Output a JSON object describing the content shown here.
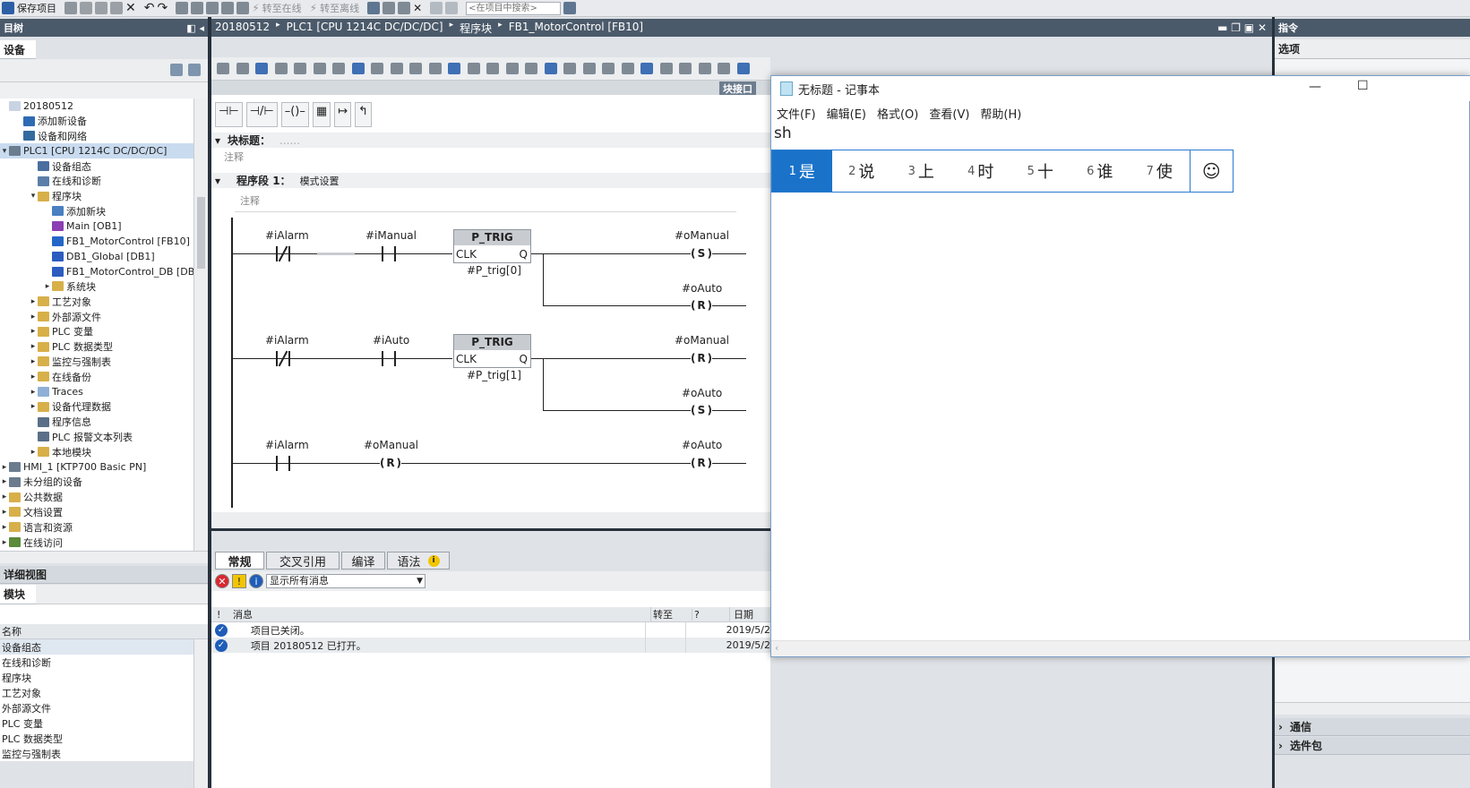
{
  "toolbar": {
    "save": "保存项目",
    "go_online": "转至在线",
    "go_offline": "转至离线",
    "search_placeholder": "<在项目中搜索>"
  },
  "left": {
    "project_tree_title": "目树",
    "devices_tab": "设备",
    "detail_view": "详细视图",
    "module_tab": "模块",
    "col_name": "名称"
  },
  "tree": [
    {
      "label": "20180512",
      "indent": 0,
      "arrow": "",
      "icon": "#c8d4e2"
    },
    {
      "label": "添加新设备",
      "indent": 1,
      "arrow": "",
      "icon": "#2f6bb3"
    },
    {
      "label": "设备和网络",
      "indent": 1,
      "arrow": "",
      "icon": "#356a9e"
    },
    {
      "label": "PLC1 [CPU 1214C DC/DC/DC]",
      "indent": 0,
      "arrow": "▾",
      "icon": "#6b7c8f",
      "sel": true
    },
    {
      "label": "设备组态",
      "indent": 2,
      "arrow": "",
      "icon": "#4b6ea0"
    },
    {
      "label": "在线和诊断",
      "indent": 2,
      "arrow": "",
      "icon": "#5b7fa8"
    },
    {
      "label": "程序块",
      "indent": 2,
      "arrow": "▾",
      "icon": "#d7b04a"
    },
    {
      "label": "添加新块",
      "indent": 3,
      "arrow": "",
      "icon": "#4a7fc1"
    },
    {
      "label": "Main [OB1]",
      "indent": 3,
      "arrow": "",
      "icon": "#8b3fb3"
    },
    {
      "label": "FB1_MotorControl [FB10]",
      "indent": 3,
      "arrow": "",
      "icon": "#2466c8"
    },
    {
      "label": "DB1_Global [DB1]",
      "indent": 3,
      "arrow": "",
      "icon": "#2c5cc0"
    },
    {
      "label": "FB1_MotorControl_DB [DB...",
      "indent": 3,
      "arrow": "",
      "icon": "#2c5cc0"
    },
    {
      "label": "系统块",
      "indent": 3,
      "arrow": "▸",
      "icon": "#d7b04a"
    },
    {
      "label": "工艺对象",
      "indent": 2,
      "arrow": "▸",
      "icon": "#d7b04a"
    },
    {
      "label": "外部源文件",
      "indent": 2,
      "arrow": "▸",
      "icon": "#d7b04a"
    },
    {
      "label": "PLC 变量",
      "indent": 2,
      "arrow": "▸",
      "icon": "#d7b04a"
    },
    {
      "label": "PLC 数据类型",
      "indent": 2,
      "arrow": "▸",
      "icon": "#d7b04a"
    },
    {
      "label": "监控与强制表",
      "indent": 2,
      "arrow": "▸",
      "icon": "#d7b04a"
    },
    {
      "label": "在线备份",
      "indent": 2,
      "arrow": "▸",
      "icon": "#d7b04a"
    },
    {
      "label": "Traces",
      "indent": 2,
      "arrow": "▸",
      "icon": "#8fb0d6"
    },
    {
      "label": "设备代理数据",
      "indent": 2,
      "arrow": "▸",
      "icon": "#d7b04a"
    },
    {
      "label": "程序信息",
      "indent": 2,
      "arrow": "",
      "icon": "#5a6f88"
    },
    {
      "label": "PLC 报警文本列表",
      "indent": 2,
      "arrow": "",
      "icon": "#5a6f88"
    },
    {
      "label": "本地模块",
      "indent": 2,
      "arrow": "▸",
      "icon": "#d7b04a"
    },
    {
      "label": "HMI_1 [KTP700 Basic PN]",
      "indent": 0,
      "arrow": "▸",
      "icon": "#6b7c8f"
    },
    {
      "label": "未分组的设备",
      "indent": 0,
      "arrow": "▸",
      "icon": "#6b7c8f"
    },
    {
      "label": "公共数据",
      "indent": 0,
      "arrow": "▸",
      "icon": "#d7b04a"
    },
    {
      "label": "文档设置",
      "indent": 0,
      "arrow": "▸",
      "icon": "#d7b04a"
    },
    {
      "label": "语言和资源",
      "indent": 0,
      "arrow": "▸",
      "icon": "#d7b04a"
    },
    {
      "label": "在线访问",
      "indent": 0,
      "arrow": "▸",
      "icon": "#5a8a3a"
    }
  ],
  "detail_rows": [
    "设备组态",
    "在线和诊断",
    "程序块",
    "工艺对象",
    "外部源文件",
    "PLC 变量",
    "PLC 数据类型",
    "监控与强制表"
  ],
  "editor": {
    "breadcrumb": [
      "20180512",
      "PLC1 [CPU 1214C DC/DC/DC]",
      "程序块",
      "FB1_MotorControl [FB10]"
    ],
    "block_interface": "块接口",
    "block_title_label": "块标题：",
    "block_title_value": "......",
    "comment": "注释",
    "network_title": "程序段 1：",
    "network_name": "模式设置"
  },
  "ladder": {
    "n1": {
      "contact1": "#iAlarm",
      "contact2": "#iManual",
      "fb": "P_TRIG",
      "clk": "CLK",
      "q": "Q",
      "inst": "#P_trig[0]",
      "coil1": "#oManual",
      "coil1_type": "S",
      "coil2": "#oAuto",
      "coil2_type": "R"
    },
    "n2": {
      "contact1": "#iAlarm",
      "contact2": "#iAuto",
      "fb": "P_TRIG",
      "clk": "CLK",
      "q": "Q",
      "inst": "#P_trig[1]",
      "coil1": "#oManual",
      "coil1_type": "R",
      "coil2": "#oAuto",
      "coil2_type": "S"
    },
    "n3": {
      "contact1": "#iAlarm",
      "mid_coil": "#oManual",
      "mid_type": "R",
      "coil": "#oAuto",
      "coil_type": "R"
    }
  },
  "inspector": {
    "tabs": [
      "常规",
      "交叉引用",
      "编译",
      "语法"
    ],
    "filter": "显示所有消息",
    "cols": {
      "ex": "!",
      "msg": "消息",
      "goto": "转至",
      "q": "?",
      "date": "日期"
    },
    "messages": [
      {
        "text": "项目已关闭。",
        "date": "2019/5/2"
      },
      {
        "text": "项目 20180512 已打开。",
        "date": "2019/5/2"
      }
    ]
  },
  "right": {
    "title": "指令",
    "options": "选项",
    "comm": "通信",
    "optional": "选件包"
  },
  "notepad": {
    "title": "无标题 - 记事本",
    "menu": [
      "文件(F)",
      "编辑(E)",
      "格式(O)",
      "查看(V)",
      "帮助(H)"
    ],
    "text": "sh",
    "ime": [
      {
        "n": "1",
        "c": "是"
      },
      {
        "n": "2",
        "c": "说"
      },
      {
        "n": "3",
        "c": "上"
      },
      {
        "n": "4",
        "c": "时"
      },
      {
        "n": "5",
        "c": "十"
      },
      {
        "n": "6",
        "c": "谁"
      },
      {
        "n": "7",
        "c": "使"
      }
    ],
    "emoji": "☺"
  },
  "colors": {
    "header_dark": "#4b5a6a",
    "accent": "#2a7bd0",
    "tree_sel": "#c9dbef"
  }
}
